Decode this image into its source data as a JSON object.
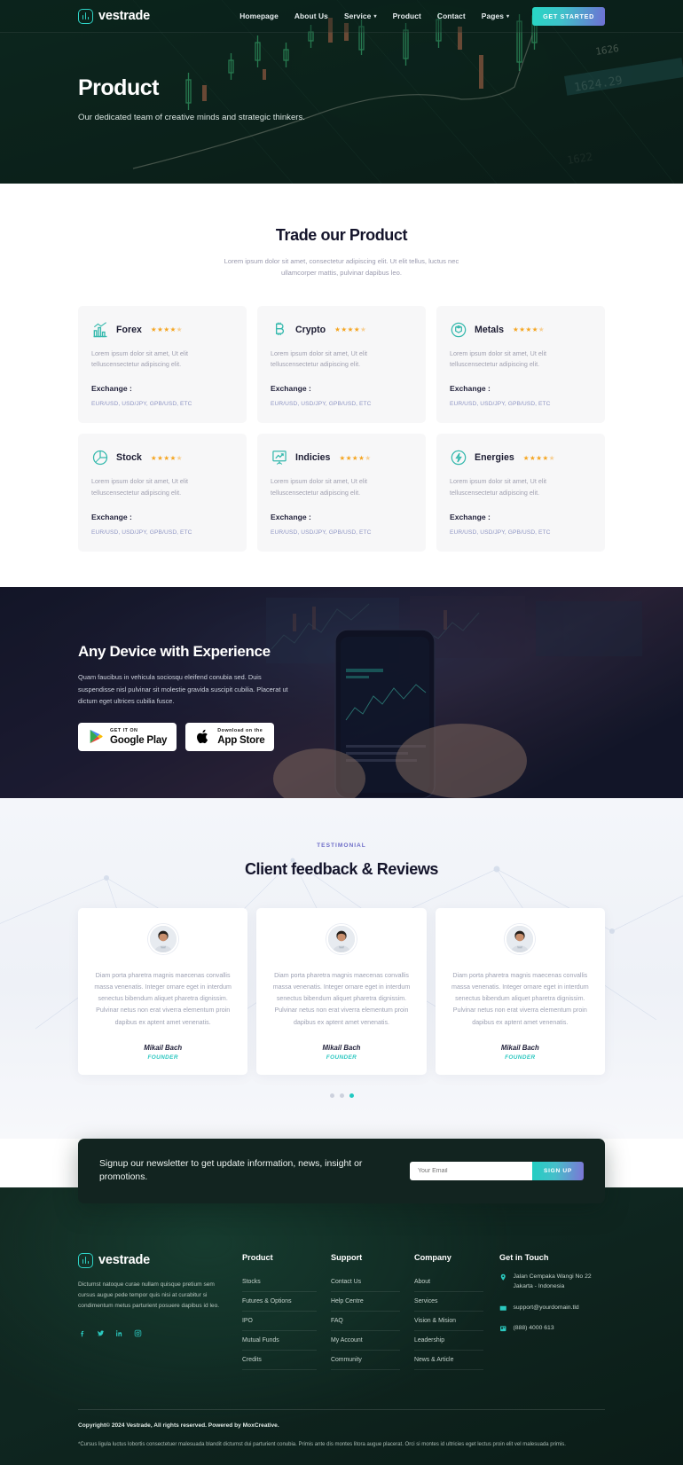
{
  "brand": {
    "name": "vestrade",
    "logo_icon": "bar-chart-rounded-square-icon"
  },
  "nav": {
    "links": [
      {
        "label": "Homepage",
        "caret": false
      },
      {
        "label": "About Us",
        "caret": false
      },
      {
        "label": "Service",
        "caret": true
      },
      {
        "label": "Product",
        "caret": false
      },
      {
        "label": "Contact",
        "caret": false
      },
      {
        "label": "Pages",
        "caret": true
      }
    ],
    "cta": "GET STARTED",
    "cta_gradient": [
      "#27d7c4",
      "#6f6fd4"
    ]
  },
  "hero": {
    "title": "Product",
    "subtitle": "Our dedicated team of creative minds and strategic thinkers."
  },
  "products": {
    "title": "Trade our Product",
    "subtitle": "Lorem ipsum dolor sit amet, consectetur adipiscing elit. Ut elit tellus, luctus nec ullamcorper mattis, pulvinar dapibus leo.",
    "exchange_label": "Exchange :",
    "cards": [
      {
        "name": "Forex",
        "icon": "bar-chart-growth-icon",
        "rating": 4.5,
        "desc": "Lorem ipsum dolor sit amet, Ut elit telluscensectetur adipiscing elit.",
        "links": "EUR/USD, USD/JPY, GPB/USD, ETC"
      },
      {
        "name": "Crypto",
        "icon": "bitcoin-icon",
        "rating": 4.5,
        "desc": "Lorem ipsum dolor sit amet, Ut elit telluscensectetur adipiscing elit.",
        "links": "EUR/USD, USD/JPY, GPB/USD, ETC"
      },
      {
        "name": "Metals",
        "icon": "cube-circle-icon",
        "rating": 4.5,
        "desc": "Lorem ipsum dolor sit amet, Ut elit telluscensectetur adipiscing elit.",
        "links": "EUR/USD, USD/JPY, GPB/USD, ETC"
      },
      {
        "name": "Stock",
        "icon": "pie-chart-icon",
        "rating": 4.5,
        "desc": "Lorem ipsum dolor sit amet, Ut elit telluscensectetur adipiscing elit.",
        "links": "EUR/USD, USD/JPY, GPB/USD, ETC"
      },
      {
        "name": "Indicies",
        "icon": "presentation-chart-icon",
        "rating": 4.5,
        "desc": "Lorem ipsum dolor sit amet, Ut elit telluscensectetur adipiscing elit.",
        "links": "EUR/USD, USD/JPY, GPB/USD, ETC"
      },
      {
        "name": "Energies",
        "icon": "bolt-circle-icon",
        "rating": 4.5,
        "desc": "Lorem ipsum dolor sit amet, Ut elit telluscensectetur adipiscing elit.",
        "links": "EUR/USD, USD/JPY, GPB/USD, ETC"
      }
    ]
  },
  "device": {
    "title": "Any Device with Experience",
    "text": "Quam faucibus in vehicula sociosqu eleifend conubia sed. Duis suspendisse nisl pulvinar sit molestie gravida suscipit cubilia. Placerat ut dictum eget ultrices cubilia fusce.",
    "stores": [
      {
        "small": "GET IT ON",
        "big": "Google Play",
        "icon": "google-play-icon"
      },
      {
        "small": "Download on the",
        "big": "App Store",
        "icon": "apple-icon"
      }
    ]
  },
  "testimonial": {
    "eyebrow": "TESTIMONIAL",
    "title": "Client feedback & Reviews",
    "cards": [
      {
        "quote": "Diam porta pharetra magnis maecenas convallis massa venenatis. Integer ornare eget in interdum senectus bibendum aliquet pharetra dignissim. Pulvinar netus non erat viverra elementum proin dapibus ex aptent amet venenatis.",
        "name": "Mikail Bach",
        "role": "FOUNDER",
        "avatar": "male-avatar-photo"
      },
      {
        "quote": "Diam porta pharetra magnis maecenas convallis massa venenatis. Integer ornare eget in interdum senectus bibendum aliquet pharetra dignissim. Pulvinar netus non erat viverra elementum proin dapibus ex aptent amet venenatis.",
        "name": "Mikail Bach",
        "role": "FOUNDER",
        "avatar": "male-avatar-photo"
      },
      {
        "quote": "Diam porta pharetra magnis maecenas convallis massa venenatis. Integer ornare eget in interdum senectus bibendum aliquet pharetra dignissim. Pulvinar netus non erat viverra elementum proin dapibus ex aptent amet venenatis.",
        "name": "Mikail Bach",
        "role": "FOUNDER",
        "avatar": "male-avatar-photo"
      }
    ],
    "dots": {
      "count": 3,
      "active_index": 2,
      "active_color": "#22c9c1"
    }
  },
  "newsletter": {
    "text": "Signup our newsletter to get update information, news, insight or promotions.",
    "input_placeholder": "Your Email",
    "input_value": "",
    "button": "SIGN UP"
  },
  "footer": {
    "brand_name": "vestrade",
    "description": "Dictumst natoque curae nullam quisque pretium sem cursus augue pede tempor quis nisi at curabitur si condimentum metus parturient posuere dapibus id leo.",
    "socials": [
      "facebook-icon",
      "twitter-icon",
      "linkedin-icon",
      "instagram-icon"
    ],
    "columns": [
      {
        "title": "Product",
        "links": [
          "Stocks",
          "Futures & Options",
          "IPO",
          "Mutual Funds",
          "Credits"
        ]
      },
      {
        "title": "Support",
        "links": [
          "Contact Us",
          "Help Centre",
          "FAQ",
          "My Account",
          "Community"
        ]
      },
      {
        "title": "Company",
        "links": [
          "About",
          "Services",
          "Vision & Mision",
          "Leadership",
          "News & Article"
        ]
      }
    ],
    "contact": {
      "title": "Get in Touch",
      "rows": [
        {
          "icon": "location-pin-icon",
          "text": "Jalan Cempaka Wangi No 22 Jakarta - Indonesia"
        },
        {
          "icon": "envelope-icon",
          "text": "support@yourdomain.tld"
        },
        {
          "icon": "phone-icon",
          "text": "(888) 4000 613"
        }
      ]
    },
    "copyright": "Copyright© 2024 Vestrade, All rights reserved. Powered by MoxCreative.",
    "fine_print": "*Cursus ligula luctus lobortis consectetuer malesuada blandit dictumst dui parturient conubia. Primis ante dis montes litora augue placerat. Orci si montes id ultricies eget lectus proin elit vel malesuada primis."
  }
}
